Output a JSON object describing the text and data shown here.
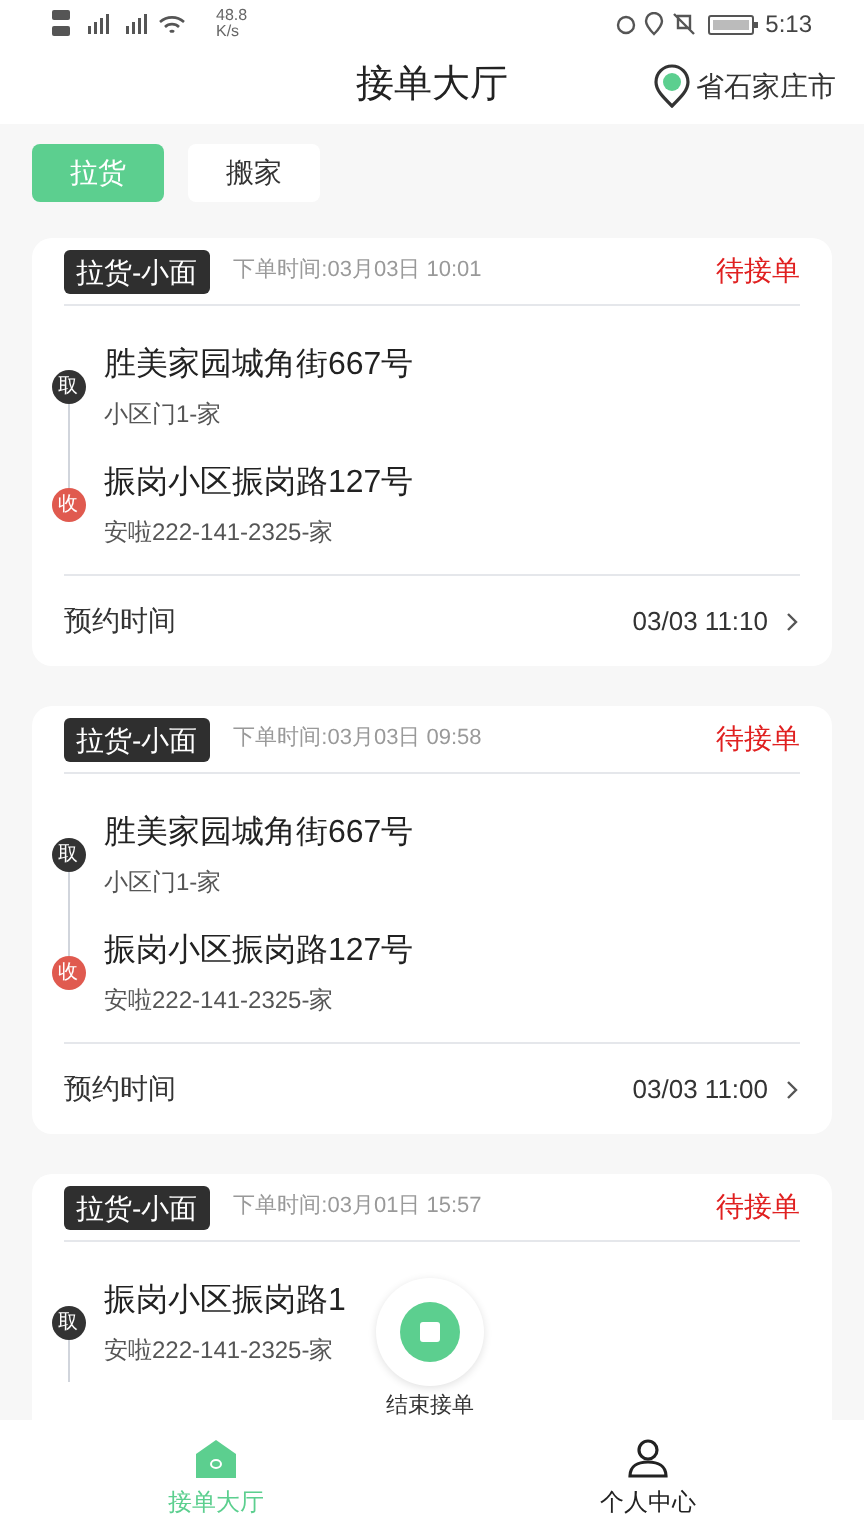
{
  "status_bar": {
    "speed_value": "48.8",
    "speed_unit": "K/s",
    "time": "5:13"
  },
  "header": {
    "title": "接单大厅",
    "location": "省石家庄市"
  },
  "tabs": [
    {
      "label": "拉货",
      "selected": true
    },
    {
      "label": "搬家",
      "selected": false
    }
  ],
  "orders": [
    {
      "tag": "拉货-小面",
      "order_time": "下单时间:03月03日 10:01",
      "status": "待接单",
      "stops": [
        {
          "kind": "pickup",
          "badge": "取",
          "address": "胜美家园城角街667号",
          "detail": "小区门1-家"
        },
        {
          "kind": "dropoff",
          "badge": "收",
          "address": "振岗小区振岗路127号",
          "detail": "安啦222-141-2325-家"
        }
      ],
      "reservation": {
        "label": "预约时间",
        "value": "03/03 11:10"
      }
    },
    {
      "tag": "拉货-小面",
      "order_time": "下单时间:03月03日 09:58",
      "status": "待接单",
      "stops": [
        {
          "kind": "pickup",
          "badge": "取",
          "address": "胜美家园城角街667号",
          "detail": "小区门1-家"
        },
        {
          "kind": "dropoff",
          "badge": "收",
          "address": "振岗小区振岗路127号",
          "detail": "安啦222-141-2325-家"
        }
      ],
      "reservation": {
        "label": "预约时间",
        "value": "03/03 11:00"
      }
    },
    {
      "tag": "拉货-小面",
      "order_time": "下单时间:03月01日 15:57",
      "status": "待接单",
      "stops": [
        {
          "kind": "pickup",
          "badge": "取",
          "address": "振岗小区振岗路1",
          "detail": "安啦222-141-2325-家"
        }
      ]
    }
  ],
  "floating_action": {
    "label": "结束接单"
  },
  "bottom_nav": [
    {
      "label": "接单大厅",
      "kind": "home",
      "selected": true
    },
    {
      "label": "个人中心",
      "kind": "profile",
      "selected": false
    }
  ]
}
